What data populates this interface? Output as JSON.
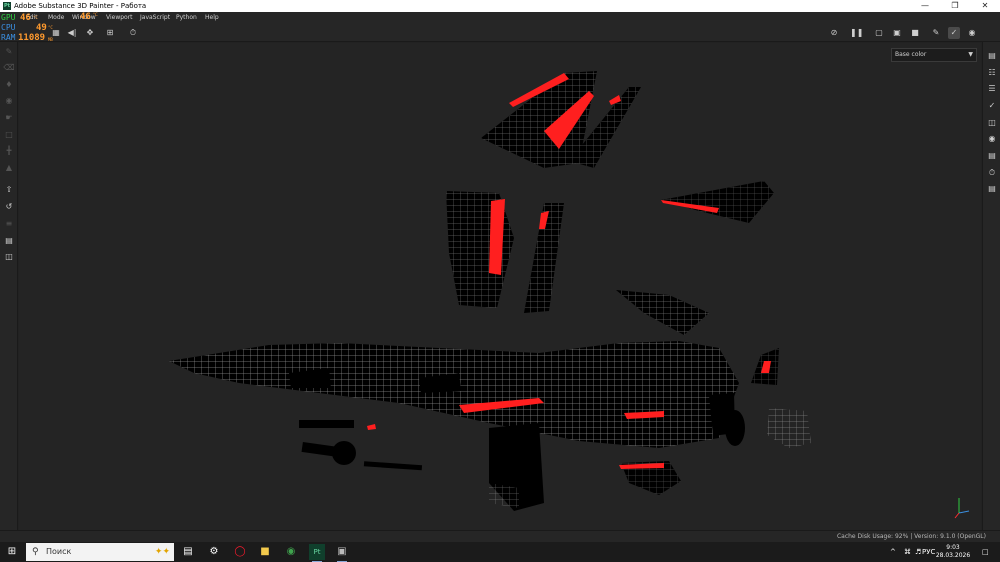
{
  "window": {
    "title": "Adobe Substance 3D Painter - Работа",
    "app_icon": "Pt",
    "controls": [
      "minimize-icon",
      "maximize-icon",
      "close-icon"
    ]
  },
  "menu": {
    "items": [
      "Edit",
      "Mode",
      "Window",
      "Viewport",
      "JavaScript",
      "Python",
      "Help"
    ]
  },
  "perf_overlay": {
    "gpu_label": "GPU",
    "gpu_value": "46",
    "gpu_unit": "°C",
    "cpu_label": "CPU",
    "cpu_value": "49",
    "cpu_unit": "°C",
    "ram_label": "RAM",
    "ram_value": "11089",
    "ram_unit": "MB",
    "window_value": "46",
    "window_unit": "°C",
    "colors": {
      "gpu": "#2ecc40",
      "cpu": "#3b8fe0",
      "ram": "#3b8fe0",
      "value": "#ff9a2e"
    }
  },
  "toolbar": {
    "left_icons": [
      "grid-icon",
      "symmetry-icon",
      "axis-icon",
      "add-icon",
      "history-icon"
    ],
    "right_icons": [
      "hide-icon",
      "pause-icon",
      "frame-icon",
      "cube-icon",
      "camera-icon",
      "edit-icon",
      "brush-icon",
      "screenshot-icon"
    ]
  },
  "left_tools": [
    "paint-brush-icon",
    "eraser-icon",
    "projection-icon",
    "geometry-mask-icon",
    "smudge-icon",
    "clone-icon",
    "color-picker-icon",
    "polygon-fill-icon",
    "bake-icon",
    "export-icon",
    "texture-set-icon",
    "document-icon",
    "shelf-icon"
  ],
  "right_tools": [
    "layers-icon",
    "texture-set-list-icon",
    "stack-icon",
    "brush-settings-icon",
    "display-icon",
    "viewer-icon",
    "shelf-panel-icon",
    "history-icon",
    "log-icon"
  ],
  "viewport": {
    "channel_select": "Base color",
    "colors": {
      "background": "#242424",
      "mesh": "#000000",
      "wire": "#c8c8c8",
      "highlight": "#ff1f1f"
    }
  },
  "status": {
    "text": "Cache Disk Usage:   92% | Version: 9.1.0 (OpenGL)"
  },
  "taskbar": {
    "search_placeholder": "Поиск",
    "apps": [
      "task-view-icon",
      "settings-icon",
      "opera-icon",
      "file-explorer-icon",
      "chrome-icon",
      "substance-painter-icon",
      "other-app-icon"
    ],
    "tray": {
      "chevron": "^",
      "lang": "РУС",
      "time": "9:03",
      "date": "28.03.2026"
    }
  }
}
